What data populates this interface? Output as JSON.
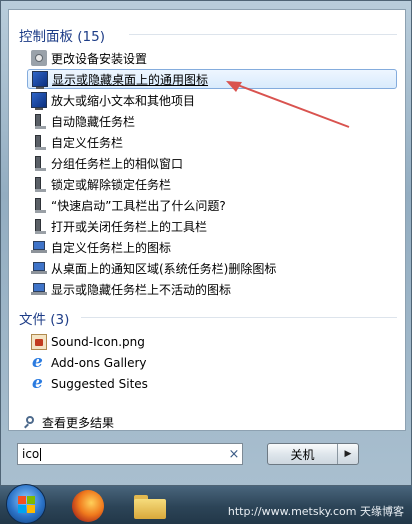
{
  "start_menu": {
    "control_panel": {
      "title": "控制面板 (15)",
      "items": [
        {
          "label": "更改设备安装设置",
          "icon": "device-settings-icon"
        },
        {
          "label": "显示或隐藏桌面上的通用图标",
          "icon": "desktop-monitor-icon",
          "selected": true
        },
        {
          "label": "放大或缩小文本和其他项目",
          "icon": "desktop-monitor-icon"
        },
        {
          "label": "自动隐藏任务栏",
          "icon": "taskbar-icon"
        },
        {
          "label": "自定义任务栏",
          "icon": "taskbar-icon"
        },
        {
          "label": "分组任务栏上的相似窗口",
          "icon": "taskbar-icon"
        },
        {
          "label": "锁定或解除锁定任务栏",
          "icon": "taskbar-icon"
        },
        {
          "label": "“快速启动”工具栏出了什么问题?",
          "icon": "taskbar-icon"
        },
        {
          "label": "打开或关闭任务栏上的工具栏",
          "icon": "taskbar-icon"
        },
        {
          "label": "自定义任务栏上的图标",
          "icon": "notification-area-icon"
        },
        {
          "label": "从桌面上的通知区域(系统任务栏)删除图标",
          "icon": "notification-area-icon"
        },
        {
          "label": "显示或隐藏任务栏上不活动的图标",
          "icon": "notification-area-icon"
        }
      ]
    },
    "files": {
      "title": "文件 (3)",
      "items": [
        {
          "label": "Sound-Icon.png",
          "icon": "png-file-icon"
        },
        {
          "label": "Add-ons Gallery",
          "icon": "ie-icon"
        },
        {
          "label": "Suggested Sites",
          "icon": "ie-icon"
        }
      ]
    },
    "see_more": "查看更多结果",
    "search": {
      "value": "ico",
      "clear": "×"
    },
    "shutdown": {
      "label": "关机",
      "arrow": "▶"
    }
  },
  "taskbar": {
    "watermark": "http://www.metsky.com 天缘博客"
  },
  "colors": {
    "section_title": "#1e3d87",
    "highlight_border": "#84acdd",
    "annotation_arrow": "#d9534f"
  }
}
